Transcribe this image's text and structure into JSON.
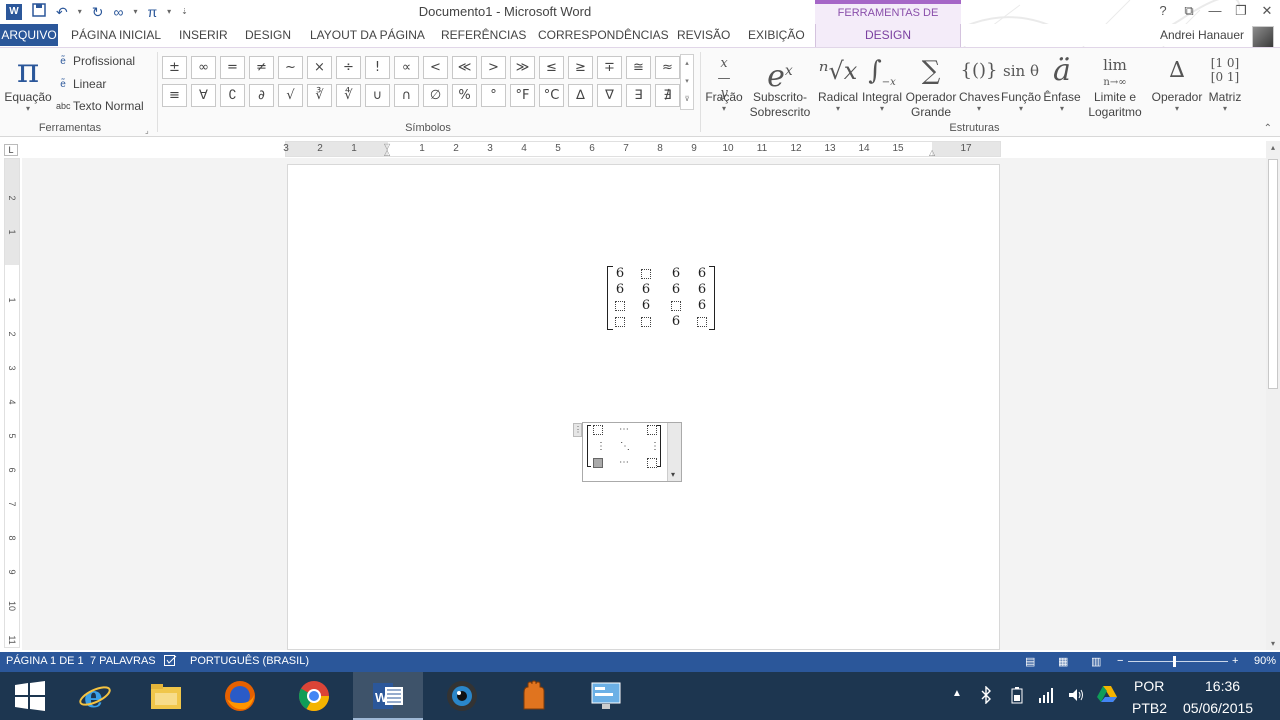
{
  "window": {
    "title": "Documento1 - Microsoft Word",
    "contextual_group": "FERRAMENTAS DE EQUAÇÃO",
    "controls": [
      "?",
      "⧉",
      "—",
      "❐",
      "✕"
    ]
  },
  "qat": {
    "undo_redo": "∞",
    "pi": "π"
  },
  "tabs": {
    "file": "ARQUIVO",
    "items": [
      "PÁGINA INICIAL",
      "INSERIR",
      "DESIGN",
      "LAYOUT DA PÁGINA",
      "REFERÊNCIAS",
      "CORRESPONDÊNCIAS",
      "REVISÃO",
      "EXIBIÇÃO"
    ],
    "active": "DESIGN"
  },
  "user": {
    "name": "Andrei Hanauer"
  },
  "ribbon": {
    "tools": {
      "label": "Ferramentas",
      "equation": "Equação",
      "professional": "Profissional",
      "linear": "Linear",
      "normal_text": "Texto Normal",
      "normal_text_prefix": "abc"
    },
    "symbols": {
      "label": "Símbolos",
      "row1": [
        "±",
        "∞",
        "=",
        "≠",
        "~",
        "×",
        "÷",
        "!",
        "∝",
        "<",
        "≪",
        ">",
        "≫",
        "≤",
        "≥",
        "∓",
        "≅",
        "≈"
      ],
      "row2": [
        "≡",
        "∀",
        "∁",
        "∂",
        "√",
        "∛",
        "∜",
        "∪",
        "∩",
        "∅",
        "%",
        "°",
        "°F",
        "°C",
        "∆",
        "∇",
        "∃",
        "∄"
      ]
    },
    "structures": {
      "label": "Estruturas",
      "items": [
        {
          "glyph": "x/y",
          "label": "Fração"
        },
        {
          "glyph": "eˣ",
          "label": "Subscrito-Sobrescrito"
        },
        {
          "glyph": "ⁿ√x",
          "label": "Radical"
        },
        {
          "glyph": "∫",
          "label": "Integral"
        },
        {
          "glyph": "∑",
          "label": "Operador Grande"
        },
        {
          "glyph": "{()}",
          "label": "Chaves"
        },
        {
          "glyph": "sin θ",
          "label": "Função"
        },
        {
          "glyph": "ä",
          "label": "Ênfase"
        },
        {
          "glyph": "lim",
          "label": "Limite e Logaritmo"
        },
        {
          "glyph": "∆",
          "label": "Operador"
        },
        {
          "glyph": "[10/01]",
          "label": "Matriz"
        }
      ]
    }
  },
  "ruler": {
    "h_labels": [
      "3",
      "2",
      "1",
      "1",
      "2",
      "3",
      "4",
      "5",
      "6",
      "7",
      "8",
      "9",
      "10",
      "11",
      "12",
      "13",
      "14",
      "15",
      "17"
    ],
    "v_labels": [
      "2",
      "1",
      "1",
      "2",
      "3",
      "4",
      "5",
      "6",
      "7",
      "8",
      "9",
      "10",
      "11"
    ]
  },
  "matrix": {
    "rows": [
      [
        "6",
        "□",
        "6",
        "6"
      ],
      [
        "6",
        "6",
        "6",
        "6"
      ],
      [
        "□",
        "6",
        "□",
        "6"
      ],
      [
        "□",
        "□",
        "6",
        "□"
      ]
    ]
  },
  "statusbar": {
    "page": "PÁGINA 1 DE 1",
    "words": "7 PALAVRAS",
    "language": "PORTUGUÊS (BRASIL)",
    "zoom": "90%",
    "zoom_level": 0.45
  },
  "taskbar": {
    "lang": "POR",
    "layout": "PTB2",
    "time": "16:36",
    "date": "05/06/2015"
  },
  "colors": {
    "word_blue": "#2b579a",
    "contextual_purple": "#a566c7",
    "taskbar": "#1d3650"
  }
}
